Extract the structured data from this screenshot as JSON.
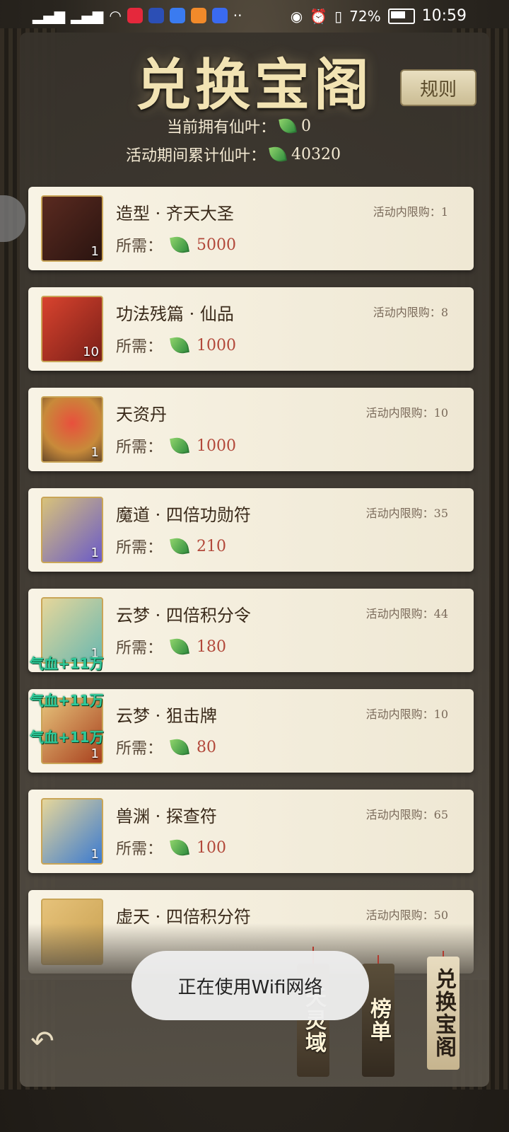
{
  "status_bar": {
    "battery": "72%",
    "time": "10:59"
  },
  "header": {
    "title": "兑换宝阁",
    "rules_label": "规则",
    "current_label": "当前拥有仙叶：",
    "current_value": "0",
    "total_label": "活动期间累计仙叶：",
    "total_value": "40320"
  },
  "items": [
    {
      "name": "造型 · 齐天大圣",
      "limit_label": "活动内限购：",
      "limit_value": "1",
      "need_label": "所需：",
      "price": "5000",
      "qty": "1"
    },
    {
      "name": "功法残篇 · 仙品",
      "limit_label": "活动内限购：",
      "limit_value": "8",
      "need_label": "所需：",
      "price": "1000",
      "qty": "10"
    },
    {
      "name": "天资丹",
      "limit_label": "活动内限购：",
      "limit_value": "10",
      "need_label": "所需：",
      "price": "1000",
      "qty": "1"
    },
    {
      "name": "魔道 · 四倍功勋符",
      "limit_label": "活动内限购：",
      "limit_value": "35",
      "need_label": "所需：",
      "price": "210",
      "qty": "1"
    },
    {
      "name": "云梦 · 四倍积分令",
      "limit_label": "活动内限购：",
      "limit_value": "44",
      "need_label": "所需：",
      "price": "180",
      "qty": "1"
    },
    {
      "name": "云梦 · 狙击牌",
      "limit_label": "活动内限购：",
      "limit_value": "10",
      "need_label": "所需：",
      "price": "80",
      "qty": "1"
    },
    {
      "name": "兽渊 · 探查符",
      "limit_label": "活动内限购：",
      "limit_value": "65",
      "need_label": "所需：",
      "price": "100",
      "qty": "1"
    },
    {
      "name": "虚天 · 四倍积分符",
      "limit_label": "活动内限购：",
      "limit_value": "50",
      "need_label": "",
      "price": "",
      "qty": ""
    }
  ],
  "floating_texts": [
    "气血+11万",
    "气血+11万",
    "气血+11万"
  ],
  "toast": "正在使用Wifi网络",
  "tabs": [
    "天灵域",
    "榜单",
    "兑换宝阁"
  ],
  "colors": {
    "title": "#f2e3b3",
    "price": "#b2483a",
    "leaf": "#4caf50",
    "float_text": "#2ec89a"
  },
  "icons": {
    "leaf": "leaf-icon",
    "back": "back-arrow-icon"
  }
}
